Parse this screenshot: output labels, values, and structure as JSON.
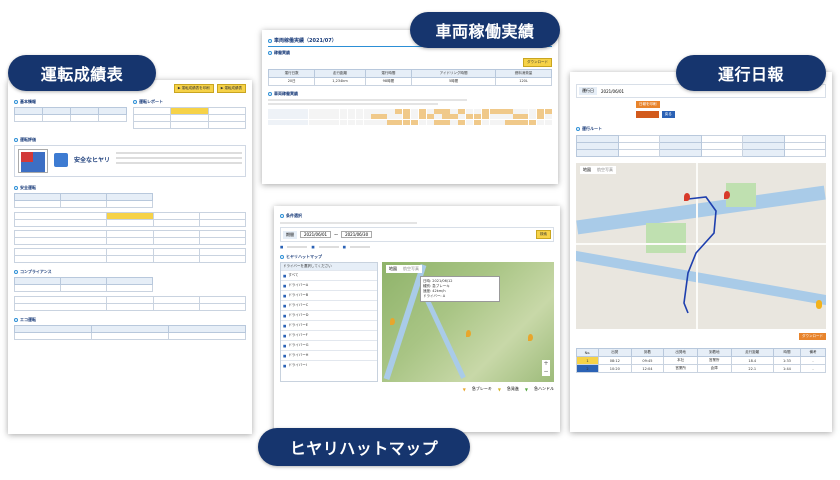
{
  "labels": {
    "driving_report": "運転成績表",
    "vehicle_operation": "車両稼働実績",
    "daily_log": "運行日報",
    "near_miss_map": "ヒヤリハットマップ"
  },
  "panel1": {
    "btn1": "▶ 運転成績表を印刷",
    "btn2": "▶ 運転成績表",
    "sec_basic": "基本情報",
    "sec_report": "運転レポート",
    "sec_eval": "運転評価",
    "sec_safety": "安全運転",
    "sec_eco": "エコ運転",
    "sec_compliance": "コンプライアンス",
    "badge": "安全なヒヤリ"
  },
  "panel2": {
    "title": "車両稼働実績（2021/07）",
    "sec1": "稼働実績",
    "sec2": "車両稼働実績",
    "columns": [
      "運行日数",
      "走行距離",
      "運行時間",
      "アイドリング時間",
      "燃料消費量"
    ],
    "values": [
      "20日",
      "1,234km",
      "98時間",
      "5時間",
      "120L"
    ],
    "btn": "ダウンロード"
  },
  "panel3": {
    "sec_search": "条件選択",
    "period_label": "期間",
    "date_from": "2021/06/01",
    "date_to": "2021/06/30",
    "search_btn": "検索",
    "sec_map": "ヒヤリハットマップ",
    "list_header": "ドライバーを選択してください",
    "drivers": [
      "すべて",
      "ドライバーA",
      "ドライバーB",
      "ドライバーC",
      "ドライバーD",
      "ドライバーE",
      "ドライバーF",
      "ドライバーG",
      "ドライバーH",
      "ドライバーI"
    ],
    "map_tab1": "地図",
    "map_tab2": "航空写真",
    "popup_lines": [
      "日時: 2021/06/12",
      "種別: 急ブレーキ",
      "速度: 42km/h",
      "ドライバー: A"
    ],
    "legend1": "急ブレーキ",
    "legend2": "急発進",
    "legend3": "急ハンドル"
  },
  "panel4": {
    "field_label": "運行日",
    "field_value": "2021/06/01",
    "btn_orange": "日報を印刷",
    "btn_blue": "戻る",
    "sec_route": "運行ルート",
    "map_tab1": "地図",
    "map_tab2": "航空写真",
    "btn_download": "ダウンロード",
    "table_headers": [
      "No.",
      "出発",
      "到着",
      "出発地",
      "到着地",
      "走行距離",
      "時間",
      "備考"
    ],
    "rows": [
      [
        "1",
        "08:12",
        "09:45",
        "本社",
        "営業所",
        "18.4",
        "1:33",
        "-"
      ],
      [
        "2",
        "10:20",
        "12:04",
        "営業所",
        "倉庫",
        "22.1",
        "1:44",
        "-"
      ]
    ]
  }
}
